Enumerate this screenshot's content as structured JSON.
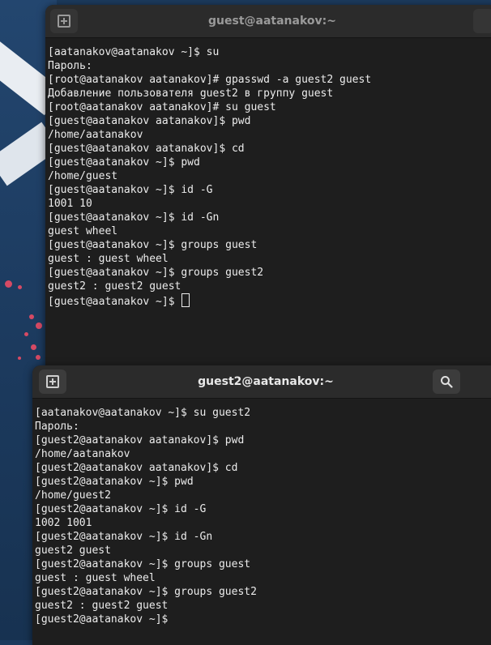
{
  "terminal1": {
    "title": "guest@aatanakov:~",
    "lines": [
      "[aatanakov@aatanakov ~]$ su",
      "Пароль:",
      "[root@aatanakov aatanakov]# gpasswd -a guest2 guest",
      "Добавление пользователя guest2 в группу guest",
      "[root@aatanakov aatanakov]# su guest",
      "[guest@aatanakov aatanakov]$ pwd",
      "/home/aatanakov",
      "[guest@aatanakov aatanakov]$ cd",
      "[guest@aatanakov ~]$ pwd",
      "/home/guest",
      "[guest@aatanakov ~]$ id -G",
      "1001 10",
      "[guest@aatanakov ~]$ id -Gn",
      "guest wheel",
      "[guest@aatanakov ~]$ groups guest",
      "guest : guest wheel",
      "[guest@aatanakov ~]$ groups guest2",
      "guest2 : guest2 guest",
      "[guest@aatanakov ~]$ "
    ]
  },
  "terminal2": {
    "title": "guest2@aatanakov:~",
    "lines": [
      "[aatanakov@aatanakov ~]$ su guest2",
      "Пароль:",
      "[guest2@aatanakov aatanakov]$ pwd",
      "/home/aatanakov",
      "[guest2@aatanakov aatanakov]$ cd",
      "[guest2@aatanakov ~]$ pwd",
      "/home/guest2",
      "[guest2@aatanakov ~]$ id -G",
      "1002 1001",
      "[guest2@aatanakov ~]$ id -Gn",
      "guest2 guest",
      "[guest2@aatanakov ~]$ groups guest",
      "guest : guest wheel",
      "[guest2@aatanakov ~]$ groups guest2",
      "guest2 : guest2 guest",
      "[guest2@aatanakov ~]$"
    ]
  },
  "colors": {
    "terminal_bg": "#1e1e1e",
    "titlebar_bg": "#2b2b2b",
    "text": "#ececec"
  }
}
